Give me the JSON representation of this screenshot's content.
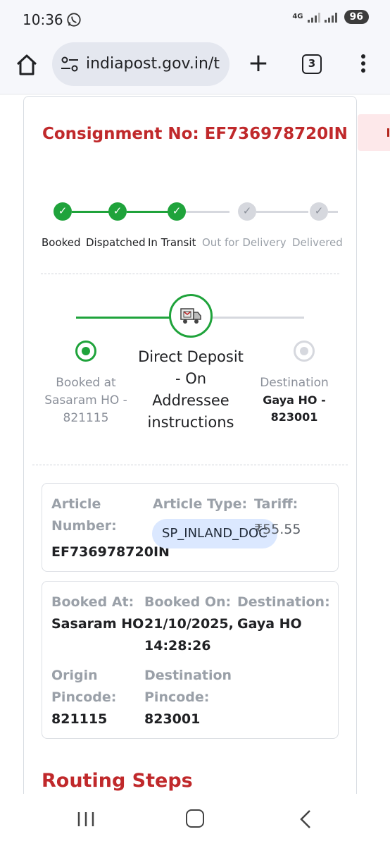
{
  "status_bar": {
    "time": "10:36",
    "network": "4G",
    "battery": "96"
  },
  "browser": {
    "url": "indiapost.gov.in/t",
    "tab_count": "3"
  },
  "consignment": {
    "title": "Consignment No: EF736978720IN"
  },
  "stepper": {
    "steps": [
      {
        "label": "Booked",
        "status": "done"
      },
      {
        "label": "Dispatched",
        "status": "done"
      },
      {
        "label": "In Transit",
        "status": "done"
      },
      {
        "label": "Out for Delivery",
        "status": "pending"
      },
      {
        "label": "Delivered",
        "status": "pending"
      }
    ]
  },
  "journey": {
    "origin_line1": "Booked at",
    "origin_line2": "Sasaram HO -",
    "origin_line3": "821115",
    "status_line1": "Direct Deposit",
    "status_line2": "- On",
    "status_line3": "Addressee",
    "status_line4": "instructions",
    "destination_label": "Destination",
    "destination_line1": "Gaya HO -",
    "destination_line2": "823001"
  },
  "article_box": {
    "article_number_label_line1": "Article",
    "article_number_label_line2": "Number:",
    "article_number": "EF736978720IN",
    "article_type_label": "Article Type:",
    "article_type": "SP_INLAND_DOC",
    "tariff_label": "Tariff:",
    "tariff": "₹55.55"
  },
  "booking_box": {
    "booked_at_label": "Booked At:",
    "booked_at": "Sasaram HO",
    "booked_on_label": "Booked On:",
    "booked_on_date": "21/10/2025,",
    "booked_on_time": "14:28:26",
    "destination_label": "Destination:",
    "destination": "Gaya HO",
    "origin_pincode_label_line1": "Origin",
    "origin_pincode_label_line2": "Pincode:",
    "origin_pincode": "821115",
    "destination_pincode_label_line1": "Destination",
    "destination_pincode_label_line2": "Pincode:",
    "destination_pincode": "823001"
  },
  "routing": {
    "title": "Routing Steps"
  },
  "colors": {
    "accent_red": "#c0292b",
    "success_green": "#1fa33b",
    "pending_grey": "#d6d8de",
    "chip_blue": "#dbe8ff"
  }
}
